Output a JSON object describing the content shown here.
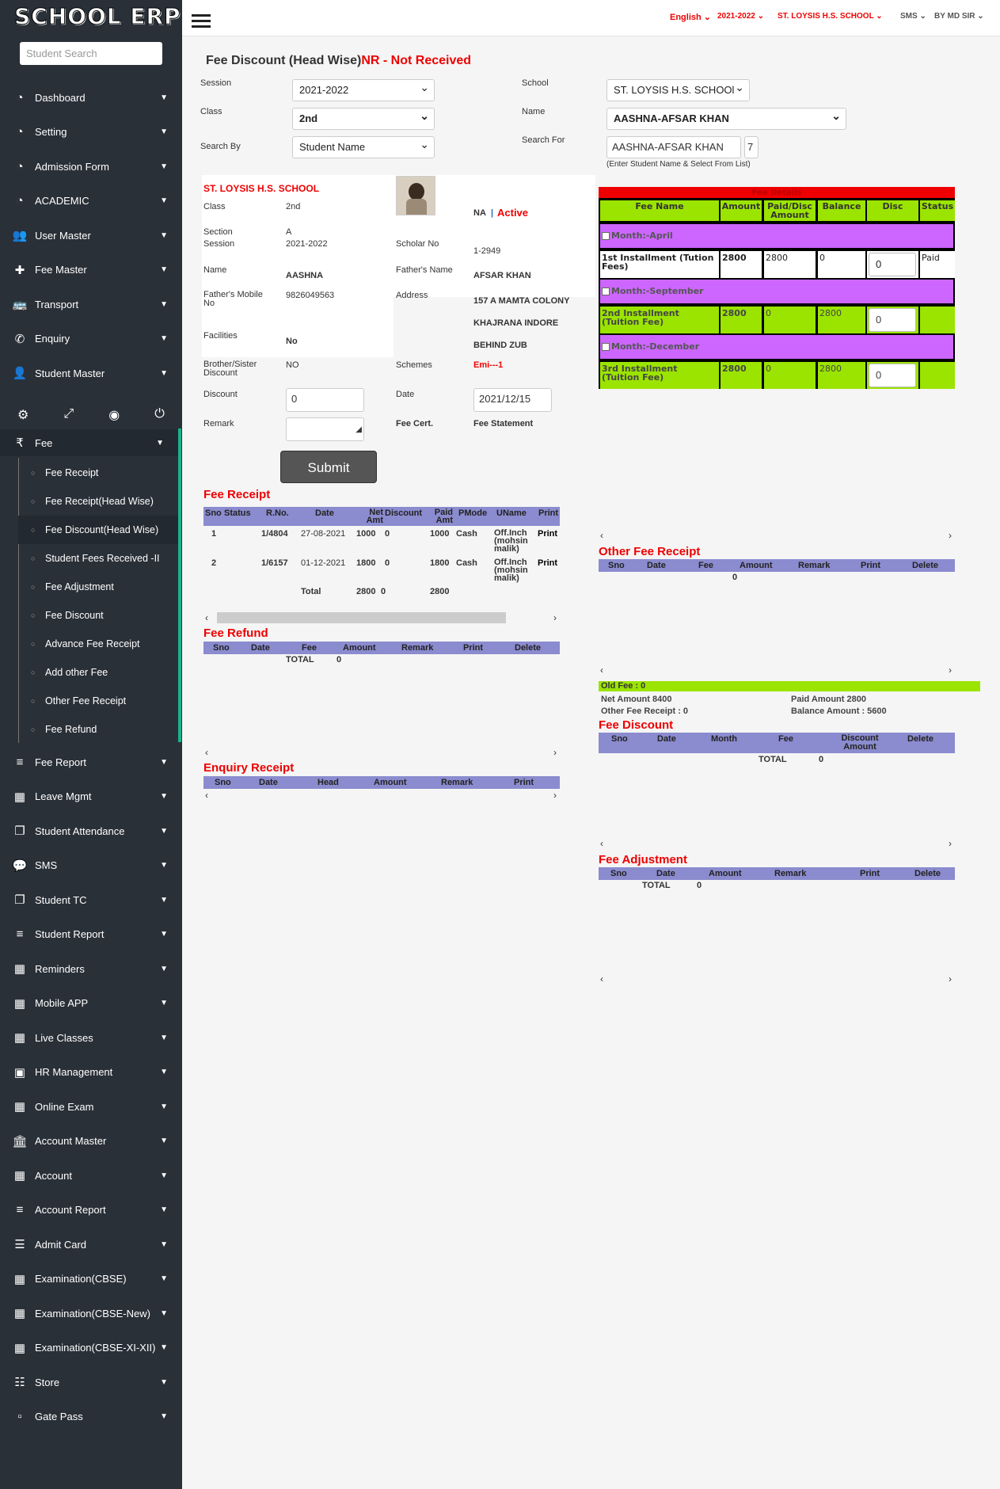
{
  "brand": "SCHOOL ERP",
  "sidebar": {
    "search_placeholder": "Student Search",
    "items": [
      {
        "icon": "dashboard-icon",
        "glyph": "◔",
        "label": "Dashboard"
      },
      {
        "icon": "dashboard-icon",
        "glyph": "◔",
        "label": "Setting"
      },
      {
        "icon": "dashboard-icon",
        "glyph": "◔",
        "label": "Admission Form"
      },
      {
        "icon": "dashboard-icon",
        "glyph": "◔",
        "label": "ACADEMIC"
      },
      {
        "icon": "users-icon",
        "glyph": "👥",
        "label": "User Master"
      },
      {
        "icon": "plus-icon",
        "glyph": "✚",
        "label": "Fee Master"
      },
      {
        "icon": "bus-icon",
        "glyph": "🚌",
        "label": "Transport"
      },
      {
        "icon": "phone-icon",
        "glyph": "✆",
        "label": "Enquiry"
      },
      {
        "icon": "user-icon",
        "glyph": "👤",
        "label": "Student Master"
      }
    ],
    "fee": {
      "icon_glyph": "₹",
      "label": "Fee"
    },
    "sub_items": [
      "Fee Receipt",
      "Fee Receipt(Head Wise)",
      "Fee Discount(Head Wise)",
      "Student Fees Received -II",
      "Fee Adjustment",
      "Fee Discount",
      "Advance Fee Receipt",
      "Add other Fee",
      "Other Fee Receipt",
      "Fee Refund"
    ],
    "items2": [
      {
        "icon": "list-icon",
        "glyph": "≡",
        "label": "Fee Report"
      },
      {
        "icon": "grid-icon",
        "glyph": "▦",
        "label": "Leave Mgmt"
      },
      {
        "icon": "copy-icon",
        "glyph": "❐",
        "label": "Student Attendance"
      },
      {
        "icon": "chat-icon",
        "glyph": "💬",
        "label": "SMS"
      },
      {
        "icon": "copy-icon",
        "glyph": "❐",
        "label": "Student TC"
      },
      {
        "icon": "list-icon",
        "glyph": "≡",
        "label": "Student Report"
      },
      {
        "icon": "calendar-icon",
        "glyph": "▦",
        "label": "Reminders"
      },
      {
        "icon": "grid-icon",
        "glyph": "▦",
        "label": "Mobile APP"
      },
      {
        "icon": "grid-icon",
        "glyph": "▦",
        "label": "Live Classes"
      },
      {
        "icon": "money-icon",
        "glyph": "▣",
        "label": "HR Management"
      },
      {
        "icon": "grid-icon",
        "glyph": "▦",
        "label": "Online Exam"
      },
      {
        "icon": "bank-icon",
        "glyph": "🏛",
        "label": "Account Master"
      },
      {
        "icon": "calculator-icon",
        "glyph": "▦",
        "label": "Account"
      },
      {
        "icon": "list-icon",
        "glyph": "≡",
        "label": "Account Report"
      },
      {
        "icon": "table-icon",
        "glyph": "☰",
        "label": "Admit Card"
      },
      {
        "icon": "grid-icon",
        "glyph": "▦",
        "label": "Examination(CBSE)"
      },
      {
        "icon": "grid-icon",
        "glyph": "▦",
        "label": "Examination(CBSE-New)"
      },
      {
        "icon": "grid-icon",
        "glyph": "▦",
        "label": "Examination(CBSE-XI-XII)"
      },
      {
        "icon": "store-icon",
        "glyph": "☷",
        "label": "Store"
      },
      {
        "icon": "gate-icon",
        "glyph": "▫",
        "label": "Gate Pass"
      }
    ]
  },
  "topnav": [
    "English",
    "2021-2022",
    "ST. LOYSIS H.S. SCHOOL",
    "SMS",
    "BY MD SIR"
  ],
  "page": {
    "title": "Fee Discount (Head Wise)",
    "nr": "NR - Not Received"
  },
  "form": {
    "session_label": "Session",
    "session": "2021-2022",
    "class_label": "Class",
    "class": "2nd",
    "searchby_label": "Search By",
    "searchby": "Student Name",
    "school_label": "School",
    "school": "ST. LOYSIS H.S. SCHOOl",
    "name_label": "Name",
    "name": "AASHNA-AFSAR KHAN",
    "searchfor_label": "Search For",
    "searchfor": "AASHNA-AFSAR KHAN",
    "searchfor_count": "7",
    "hint": "(Enter Student Name & Select From List)"
  },
  "student": {
    "school": "ST. LOYSIS H.S. SCHOOL",
    "class_l": "Class",
    "class": "2nd",
    "section_l": "Section",
    "section": "A",
    "session_l": "Session",
    "session": "2021-2022",
    "name_l": "Name",
    "name": "AASHNA",
    "fmobile_l": "Father's Mobile No",
    "fmobile": "9826049563",
    "facilities_l": "Facilities",
    "facilities": "No",
    "sibling_l": "Brother/Sister Discount",
    "sibling": "NO",
    "discount_l": "Discount",
    "discount": "0",
    "remark_l": "Remark",
    "na": "NA",
    "sep": "|",
    "status": "Active",
    "scholar_l": "Scholar No",
    "scholar": "1-2949",
    "father_l": "Father's Name",
    "father": "AFSAR KHAN",
    "address_l": "Address",
    "addr1": "157 A MAMTA COLONY",
    "addr2": "KHAJRANA INDORE",
    "addr3": "BEHIND ZUB",
    "schemes_l": "Schemes",
    "schemes": "Emi---1",
    "date_l": "Date",
    "date": "2021/12/15",
    "feecert": "Fee Cert.",
    "feestmt": "Fee Statement",
    "submit": "Submit"
  },
  "fee_details": {
    "title": "Fee Details",
    "headers": [
      "Fee Name",
      "Amount",
      "Paid/Disc Amount",
      "Balance",
      "Disc",
      "Status"
    ],
    "groups": [
      {
        "month": "Month:-April",
        "name": "1st Installment (Tution Fees)",
        "amount": "2800",
        "paid": "2800",
        "balance": "0",
        "disc": "0",
        "status": "Paid"
      },
      {
        "month": "Month:-September",
        "name": "2nd Installment (Tuition Fee)",
        "amount": "2800",
        "paid": "0",
        "balance": "2800",
        "disc": "0",
        "status": ""
      },
      {
        "month": "Month:-December",
        "name": "3rd Installment (Tuition Fee)",
        "amount": "2800",
        "paid": "0",
        "balance": "2800",
        "disc": "0",
        "status": ""
      }
    ]
  },
  "fee_receipt": {
    "title": "Fee Receipt",
    "headers": [
      "Sno",
      "Status",
      "R.No.",
      "Date",
      "Net Amt",
      "Discount",
      "Paid Amt",
      "PMode",
      "UName",
      "Print"
    ],
    "rows": [
      {
        "sno": "1",
        "rno": "1/4804",
        "date": "27-08-2021",
        "net": "1000",
        "disc": "0",
        "paid": "1000",
        "mode": "Cash",
        "uname": "Off.Inch (mohsin malik)",
        "print": "Print"
      },
      {
        "sno": "2",
        "rno": "1/6157",
        "date": "01-12-2021",
        "net": "1800",
        "disc": "0",
        "paid": "1800",
        "mode": "Cash",
        "uname": "Off.Inch (mohsin malik)",
        "print": "Print"
      }
    ],
    "total_l": "Total",
    "total_net": "2800",
    "total_disc": "0",
    "total_paid": "2800"
  },
  "fee_refund": {
    "title": "Fee Refund",
    "headers": [
      "Sno",
      "Date",
      "Fee",
      "Amount",
      "Remark",
      "Print",
      "Delete"
    ],
    "total_l": "TOTAL",
    "total": "0"
  },
  "enquiry": {
    "title": "Enquiry Receipt",
    "headers": [
      "Sno",
      "Date",
      "Head",
      "Amount",
      "Remark",
      "Print"
    ]
  },
  "other_fee": {
    "title": "Other Fee Receipt",
    "headers": [
      "Sno",
      "Date",
      "Fee",
      "Amount",
      "Remark",
      "Print",
      "Delete"
    ],
    "total": "0"
  },
  "summary": {
    "old_fee": "Old Fee : 0",
    "net": "Net Amount 8400",
    "paid": "Paid Amount 2800",
    "other": "Other Fee Receipt : 0",
    "balance": "Balance Amount : 5600"
  },
  "fee_discount": {
    "title": "Fee Discount",
    "headers": [
      "Sno",
      "Date",
      "Month",
      "Fee",
      "Discount Amount",
      "Delete"
    ],
    "total_l": "TOTAL",
    "total": "0"
  },
  "fee_adjust": {
    "title": "Fee Adjustment",
    "headers": [
      "Sno",
      "Date",
      "Amount",
      "Remark",
      "Print",
      "Delete"
    ],
    "total_l": "TOTAL",
    "total": "0"
  }
}
